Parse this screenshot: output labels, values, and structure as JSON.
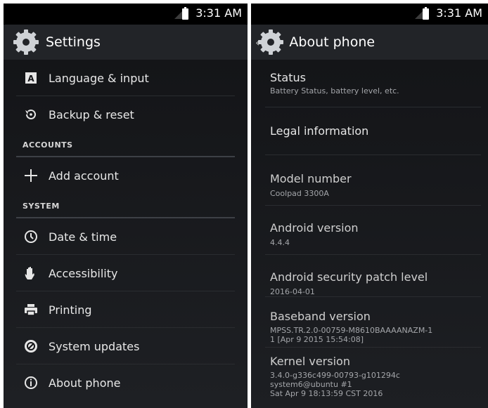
{
  "left": {
    "status_time": "3:31 AM",
    "title": "Settings",
    "rows": [
      {
        "label": "Language & input",
        "icon": "language-icon"
      },
      {
        "label": "Backup & reset",
        "icon": "backup-icon"
      }
    ],
    "accounts_header": "ACCOUNTS",
    "add_account": "Add account",
    "system_header": "SYSTEM",
    "system_rows": [
      {
        "label": "Date & time",
        "icon": "clock-icon"
      },
      {
        "label": "Accessibility",
        "icon": "hand-icon"
      },
      {
        "label": "Printing",
        "icon": "printer-icon"
      },
      {
        "label": "System updates",
        "icon": "system-update-icon"
      },
      {
        "label": "About phone",
        "icon": "info-icon"
      }
    ]
  },
  "right": {
    "status_time": "3:31 AM",
    "title": "About phone",
    "items": [
      {
        "title": "Status",
        "summary": "Battery Status, battery level, etc."
      },
      {
        "title": "Legal information",
        "summary": ""
      },
      {
        "title": "Model number",
        "summary": "Coolpad 3300A"
      },
      {
        "title": "Android version",
        "summary": "4.4.4"
      },
      {
        "title": "Android security patch level",
        "summary": "2016-04-01"
      },
      {
        "title": "Baseband version",
        "summary": "MPSS.TR.2.0-00759-M8610BAAAANAZM-1",
        "summary2": "1  [Apr  9 2015 15:54:08]"
      },
      {
        "title": "Kernel version",
        "summary": "3.4.0-g336c499-00793-g101294c",
        "summary2": "system6@ubuntu #1",
        "summary3": "Sat Apr 9 18:13:59 CST 2016"
      }
    ]
  }
}
